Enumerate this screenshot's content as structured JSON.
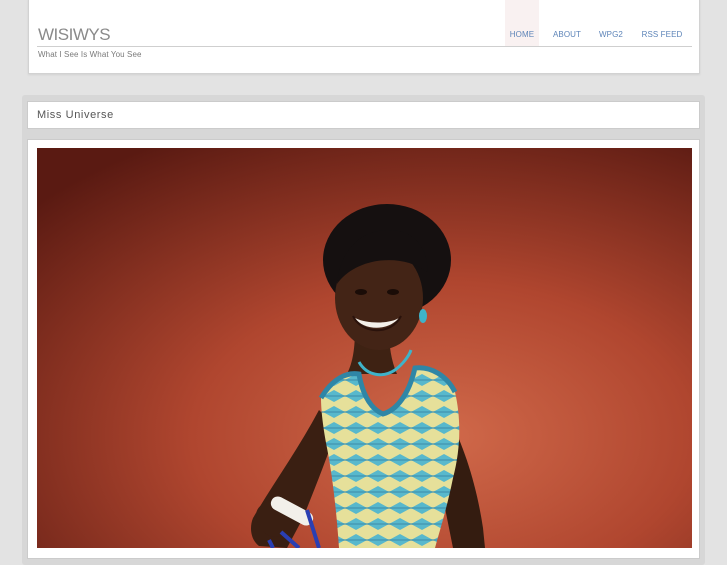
{
  "site": {
    "title": "WISIWYS",
    "tagline": "What I See Is What You See"
  },
  "nav": {
    "items": [
      {
        "label": "HOME",
        "active": true
      },
      {
        "label": "ABOUT",
        "active": false
      },
      {
        "label": "WPG2",
        "active": false
      },
      {
        "label": "RSS FEED",
        "active": false
      }
    ]
  },
  "post": {
    "title": "Miss Universe"
  },
  "colors": {
    "background": "#e3e3e3",
    "link": "#5d84b8",
    "photo_backdrop": "#b4513a"
  }
}
